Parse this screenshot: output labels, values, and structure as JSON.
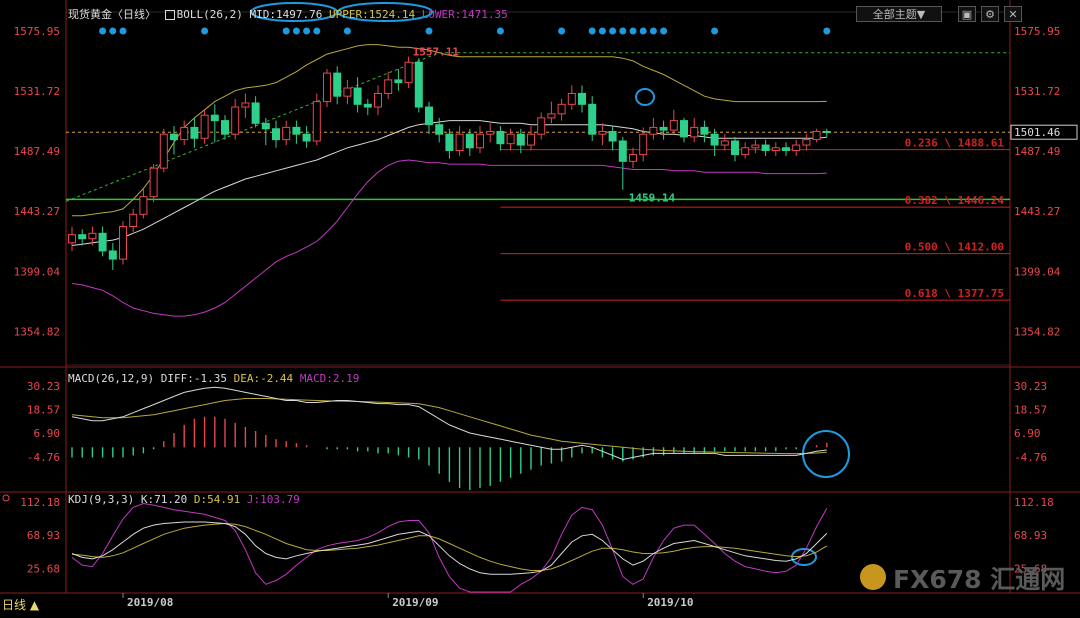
{
  "header": {
    "instrument": "现货黄金",
    "period_tag": "〈日线〉",
    "boll": {
      "name": "BOLL(26,2)",
      "mid": "MID:1497.76",
      "upper": "UPPER:1524.14",
      "lower": "LOWER:1471.35"
    },
    "macd": {
      "name": "MACD(26,12,9)",
      "diff": "DIFF:-1.35",
      "dea": "DEA:-2.44",
      "macd": "MACD:2.19"
    },
    "kdj": {
      "name": "KDJ(9,3,3)",
      "k": "K:71.20",
      "d": "D:54.91",
      "j": "J:103.79"
    }
  },
  "toolbar": {
    "theme_label": "全部主题▼"
  },
  "period_button": "日线 ▲",
  "watermark": "FX678 汇通网",
  "colors": {
    "up": "#e8474f",
    "down": "#2ecf8a",
    "mid": "#d8d8d8",
    "band": "#b9a93a",
    "lower_band": "#c238c2",
    "dea": "#b9a93a",
    "diff": "#d8d8d8",
    "k": "#d8d8d8",
    "d": "#b9a93a",
    "j": "#c238c2",
    "accent": "#1e9be0",
    "fib": "#d32020",
    "support": "#2ec52e"
  },
  "chart_data": [
    {
      "type": "candlestick",
      "x_ticks": [
        "2019/08",
        "2019/09",
        "2019/10"
      ],
      "y_ticks": [
        "1575.95",
        "1531.72",
        "1487.49",
        "1443.27",
        "1399.04",
        "1354.82"
      ],
      "ylim": [
        1330,
        1590
      ],
      "current_price": "1501.46",
      "annotations": {
        "high": "1557.11",
        "low": "1459.14"
      },
      "fib_levels": [
        {
          "label": "0.236 \\ 1488.61",
          "value": 1488.61
        },
        {
          "label": "0.382 \\ 1446.24",
          "value": 1446.24
        },
        {
          "label": "0.500 \\ 1412.00",
          "value": 1412.0
        },
        {
          "label": "0.618 \\ 1377.75",
          "value": 1377.75
        }
      ],
      "support_level": 1452,
      "resistance_trend": [
        [
          0,
          1452
        ],
        [
          36,
          1560
        ]
      ],
      "resistance_level": 1560,
      "candles": [
        [
          1420,
          1426,
          1414,
          1432
        ],
        [
          1426,
          1423,
          1418,
          1430
        ],
        [
          1423,
          1427,
          1418,
          1432
        ],
        [
          1427,
          1414,
          1410,
          1432
        ],
        [
          1414,
          1408,
          1400,
          1420
        ],
        [
          1408,
          1432,
          1404,
          1436
        ],
        [
          1432,
          1441,
          1428,
          1445
        ],
        [
          1441,
          1454,
          1438,
          1460
        ],
        [
          1454,
          1475,
          1450,
          1478
        ],
        [
          1475,
          1500,
          1472,
          1504
        ],
        [
          1500,
          1496,
          1485,
          1506
        ],
        [
          1496,
          1505,
          1492,
          1510
        ],
        [
          1505,
          1497,
          1490,
          1512
        ],
        [
          1497,
          1514,
          1493,
          1518
        ],
        [
          1514,
          1510,
          1494,
          1522
        ],
        [
          1510,
          1500,
          1496,
          1514
        ],
        [
          1500,
          1520,
          1496,
          1526
        ],
        [
          1520,
          1523,
          1512,
          1530
        ],
        [
          1523,
          1508,
          1505,
          1528
        ],
        [
          1508,
          1504,
          1492,
          1512
        ],
        [
          1504,
          1496,
          1490,
          1510
        ],
        [
          1496,
          1505,
          1492,
          1510
        ],
        [
          1505,
          1500,
          1493,
          1510
        ],
        [
          1500,
          1495,
          1490,
          1506
        ],
        [
          1495,
          1524,
          1492,
          1530
        ],
        [
          1524,
          1545,
          1520,
          1548
        ],
        [
          1545,
          1528,
          1522,
          1550
        ],
        [
          1528,
          1534,
          1522,
          1540
        ],
        [
          1534,
          1522,
          1516,
          1542
        ],
        [
          1522,
          1520,
          1514,
          1526
        ],
        [
          1520,
          1530,
          1514,
          1536
        ],
        [
          1530,
          1540,
          1526,
          1546
        ],
        [
          1540,
          1538,
          1532,
          1548
        ],
        [
          1538,
          1553,
          1534,
          1557.11
        ],
        [
          1553,
          1520,
          1516,
          1556
        ],
        [
          1520,
          1507,
          1500,
          1524
        ],
        [
          1507,
          1500,
          1494,
          1512
        ],
        [
          1500,
          1488,
          1482,
          1504
        ],
        [
          1488,
          1500,
          1484,
          1506
        ],
        [
          1500,
          1490,
          1484,
          1504
        ],
        [
          1490,
          1500,
          1486,
          1506
        ],
        [
          1500,
          1502,
          1494,
          1508
        ],
        [
          1502,
          1493,
          1488,
          1506
        ],
        [
          1493,
          1500,
          1488,
          1504
        ],
        [
          1500,
          1492,
          1486,
          1504
        ],
        [
          1492,
          1500,
          1488,
          1506
        ],
        [
          1500,
          1512,
          1496,
          1516
        ],
        [
          1512,
          1515,
          1508,
          1524
        ],
        [
          1515,
          1522,
          1510,
          1526
        ],
        [
          1522,
          1530,
          1518,
          1536
        ],
        [
          1530,
          1522,
          1516,
          1536
        ],
        [
          1522,
          1500,
          1495,
          1528
        ],
        [
          1500,
          1502,
          1492,
          1508
        ],
        [
          1502,
          1495,
          1488,
          1506
        ],
        [
          1495,
          1480,
          1459.14,
          1498
        ],
        [
          1480,
          1485,
          1475,
          1490
        ],
        [
          1485,
          1500,
          1480,
          1505
        ],
        [
          1500,
          1505,
          1496,
          1512
        ],
        [
          1505,
          1503,
          1496,
          1510
        ],
        [
          1503,
          1510,
          1500,
          1518
        ],
        [
          1510,
          1498,
          1494,
          1512
        ],
        [
          1498,
          1505,
          1494,
          1512
        ],
        [
          1505,
          1500,
          1494,
          1510
        ],
        [
          1500,
          1492,
          1484,
          1504
        ],
        [
          1492,
          1495,
          1488,
          1500
        ],
        [
          1495,
          1485,
          1480,
          1498
        ],
        [
          1485,
          1490,
          1482,
          1494
        ],
        [
          1490,
          1492,
          1486,
          1496
        ],
        [
          1492,
          1488,
          1484,
          1496
        ],
        [
          1488,
          1490,
          1484,
          1494
        ],
        [
          1490,
          1488,
          1484,
          1494
        ],
        [
          1488,
          1492,
          1484,
          1496
        ],
        [
          1492,
          1496,
          1488,
          1500
        ],
        [
          1496,
          1502,
          1494,
          1504
        ],
        [
          1502,
          1501.46,
          1498,
          1504
        ]
      ],
      "boll_mid": [
        1418,
        1419,
        1420,
        1421,
        1422,
        1424,
        1427,
        1430,
        1434,
        1438,
        1442,
        1446,
        1450,
        1454,
        1458,
        1461,
        1464,
        1467,
        1469,
        1471,
        1473,
        1475,
        1477,
        1479,
        1481,
        1484,
        1487,
        1490,
        1492,
        1494,
        1496,
        1499,
        1502,
        1505,
        1507,
        1508,
        1509,
        1510,
        1510,
        1510,
        1510,
        1509,
        1508,
        1508,
        1508,
        1507,
        1507,
        1507,
        1507,
        1507,
        1507,
        1507,
        1507,
        1506,
        1505,
        1504,
        1502,
        1501,
        1500,
        1500,
        1499,
        1499,
        1498,
        1497,
        1497,
        1497,
        1497,
        1497,
        1497,
        1497,
        1497,
        1497,
        1497,
        1497,
        1497.76
      ],
      "boll_upper": [
        1440,
        1440,
        1441,
        1442,
        1443,
        1445,
        1452,
        1460,
        1470,
        1482,
        1494,
        1505,
        1512,
        1518,
        1524,
        1528,
        1532,
        1534,
        1535,
        1536,
        1538,
        1542,
        1546,
        1551,
        1555,
        1559,
        1561,
        1563,
        1565,
        1566,
        1566,
        1565,
        1564,
        1564,
        1563,
        1562,
        1560,
        1558,
        1557,
        1557,
        1557,
        1557,
        1557,
        1557,
        1557,
        1557,
        1557,
        1557,
        1557,
        1557,
        1557,
        1557,
        1557,
        1557,
        1556,
        1554,
        1550,
        1547,
        1544,
        1540,
        1536,
        1532,
        1528,
        1526,
        1525,
        1524,
        1524,
        1524,
        1524,
        1524,
        1524,
        1524,
        1524,
        1524,
        1524.14
      ],
      "boll_lower": [
        1390,
        1389,
        1387,
        1385,
        1381,
        1376,
        1372,
        1370,
        1368,
        1367,
        1366,
        1366,
        1367,
        1369,
        1372,
        1376,
        1382,
        1388,
        1394,
        1400,
        1406,
        1410,
        1413,
        1417,
        1421,
        1428,
        1436,
        1446,
        1456,
        1465,
        1472,
        1477,
        1480,
        1481,
        1480,
        1479,
        1479,
        1478,
        1478,
        1478,
        1478,
        1477,
        1477,
        1477,
        1477,
        1477,
        1477,
        1477,
        1477,
        1477,
        1477,
        1477,
        1477,
        1476,
        1475,
        1474,
        1474,
        1474,
        1474,
        1473,
        1473,
        1473,
        1472,
        1472,
        1472,
        1472,
        1472,
        1472,
        1471,
        1471,
        1471,
        1471,
        1471,
        1471,
        1471.35
      ]
    },
    {
      "type": "macd",
      "y_ticks": [
        "30.23",
        "18.57",
        "6.90",
        "-4.76"
      ],
      "ylim": [
        -22,
        38
      ],
      "diff": [
        15,
        14,
        13,
        13,
        14,
        15,
        17,
        19,
        21,
        23,
        25,
        27,
        28,
        29,
        29.5,
        29,
        28,
        27,
        26,
        25,
        24,
        23,
        23,
        22,
        22,
        22.5,
        23,
        23,
        22.5,
        22,
        21.5,
        21.5,
        21,
        21,
        20,
        17,
        14,
        11,
        9,
        7,
        6,
        5,
        4,
        3,
        2,
        1,
        0,
        -1,
        -1,
        0,
        1,
        0,
        -2,
        -4,
        -6,
        -5,
        -4,
        -3,
        -3,
        -3,
        -3,
        -3,
        -3,
        -3,
        -4,
        -4,
        -4,
        -4,
        -4,
        -4,
        -4,
        -4,
        -3,
        -2,
        -1.35
      ],
      "dea": [
        16,
        15.5,
        15,
        14.5,
        14.5,
        14.5,
        15,
        15.5,
        16,
        17,
        18,
        19,
        20,
        21,
        22,
        23,
        23.5,
        24,
        24,
        24,
        23.8,
        23.6,
        23.4,
        23.2,
        23,
        22.8,
        22.7,
        22.6,
        22.5,
        22.4,
        22.2,
        22,
        21.8,
        21.6,
        21.4,
        20.5,
        19.5,
        18,
        16.5,
        15,
        13.5,
        12,
        10.5,
        9,
        7.5,
        6,
        5,
        4,
        3,
        2.5,
        2,
        1.5,
        1,
        0.5,
        0,
        -0.5,
        -1,
        -1.3,
        -1.6,
        -1.8,
        -2,
        -2.2,
        -2.3,
        -2.4,
        -2.5,
        -2.6,
        -2.7,
        -2.8,
        -2.9,
        -3,
        -3.1,
        -3.1,
        -3,
        -2.8,
        -2.44
      ],
      "histogram": [
        -5,
        -5,
        -5,
        -5,
        -5,
        -5,
        -4,
        -3,
        -1,
        3,
        7,
        11,
        14,
        15,
        15,
        14,
        12,
        10,
        8,
        6,
        4,
        3,
        2,
        1,
        0,
        -1,
        -1,
        -1,
        -2,
        -2,
        -3,
        -3,
        -4,
        -5,
        -6,
        -9,
        -13,
        -17,
        -20,
        -21,
        -20,
        -19,
        -17,
        -15,
        -13,
        -11,
        -9,
        -8,
        -7,
        -5,
        -3,
        -3,
        -5,
        -6,
        -7,
        -6,
        -5,
        -4,
        -4,
        -3,
        -3,
        -3,
        -3,
        -2,
        -2,
        -2,
        -2,
        -2,
        -2,
        -2,
        -1,
        -1,
        0,
        1,
        2.19
      ]
    },
    {
      "type": "kdj",
      "y_ticks": [
        "112.18",
        "68.93",
        "25.68"
      ],
      "ylim": [
        -5,
        125
      ],
      "k": [
        45,
        40,
        38,
        42,
        50,
        60,
        70,
        78,
        82,
        84,
        85,
        86,
        86,
        86,
        85,
        84,
        80,
        70,
        55,
        45,
        40,
        38,
        42,
        45,
        48,
        50,
        52,
        54,
        56,
        58,
        62,
        66,
        70,
        72,
        74,
        68,
        55,
        42,
        32,
        25,
        20,
        18,
        18,
        18,
        19,
        20,
        22,
        30,
        45,
        60,
        68,
        70,
        62,
        50,
        38,
        30,
        35,
        45,
        52,
        58,
        60,
        62,
        58,
        54,
        50,
        46,
        42,
        40,
        38,
        36,
        35,
        38,
        45,
        58,
        71.2
      ],
      "d": [
        44,
        43,
        41,
        40,
        42,
        46,
        52,
        58,
        64,
        70,
        74,
        78,
        80,
        82,
        83,
        84,
        83,
        80,
        75,
        70,
        64,
        58,
        54,
        50,
        49,
        49,
        50,
        51,
        52,
        54,
        56,
        59,
        62,
        65,
        68,
        68,
        64,
        58,
        52,
        46,
        40,
        35,
        31,
        28,
        25,
        23,
        23,
        25,
        30,
        36,
        42,
        48,
        52,
        52,
        50,
        47,
        45,
        45,
        46,
        48,
        51,
        53,
        54,
        54,
        53,
        52,
        50,
        48,
        46,
        44,
        42,
        41,
        42,
        47,
        54.91
      ],
      "j": [
        40,
        30,
        28,
        45,
        68,
        90,
        105,
        110,
        108,
        105,
        102,
        100,
        98,
        96,
        92,
        88,
        75,
        50,
        20,
        5,
        10,
        18,
        30,
        40,
        50,
        55,
        58,
        60,
        62,
        66,
        72,
        80,
        86,
        88,
        88,
        72,
        40,
        15,
        0,
        -5,
        -5,
        -5,
        -5,
        -5,
        5,
        12,
        22,
        40,
        70,
        95,
        105,
        102,
        82,
        50,
        15,
        5,
        12,
        40,
        62,
        78,
        82,
        82,
        70,
        58,
        45,
        35,
        28,
        25,
        22,
        20,
        22,
        30,
        52,
        80,
        103.79
      ]
    }
  ]
}
